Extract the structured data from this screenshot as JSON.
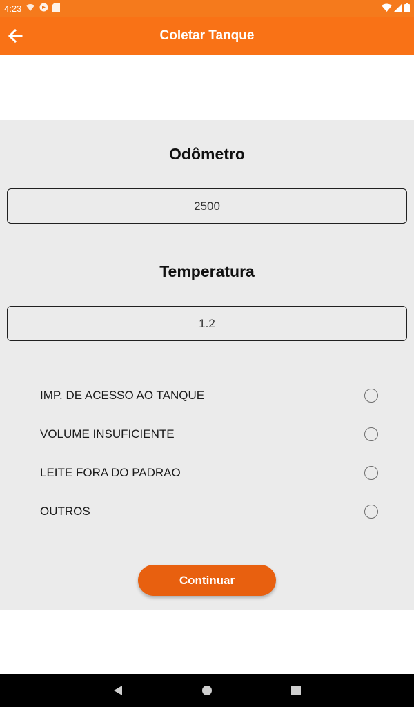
{
  "status_bar": {
    "time": "4:23",
    "icons": [
      "wifi-hotspot-icon",
      "vpn-icon",
      "sd-card-icon",
      "wifi-icon",
      "signal-icon",
      "battery-icon"
    ]
  },
  "app_bar": {
    "title": "Coletar Tanque",
    "back_icon": "arrow-left-icon",
    "background": "#f97216"
  },
  "form": {
    "odometer": {
      "label": "Odômetro",
      "value": "2500"
    },
    "temperature": {
      "label": "Temperatura",
      "value": "1.2"
    },
    "options": [
      {
        "label": "IMP. DE ACESSO AO TANQUE",
        "selected": false
      },
      {
        "label": "VOLUME INSUFICIENTE",
        "selected": false
      },
      {
        "label": "LEITE FORA DO PADRAO",
        "selected": false
      },
      {
        "label": "OUTROS",
        "selected": false
      }
    ],
    "continue_label": "Continuar"
  },
  "colors": {
    "accent": "#f97216",
    "button": "#e8600f",
    "panel": "#ebebeb"
  },
  "nav_bar": {
    "icons": [
      "back-triangle-icon",
      "home-circle-icon",
      "recents-square-icon"
    ]
  }
}
